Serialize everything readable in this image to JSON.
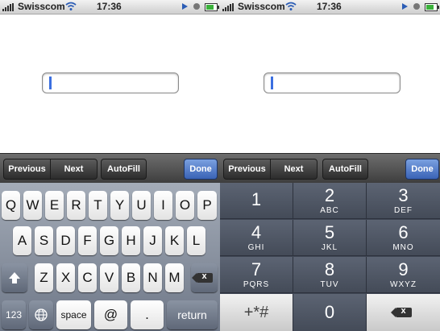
{
  "status_bar": {
    "carrier": "Swisscom",
    "time": "17:36"
  },
  "accessory_bar": {
    "previous": "Previous",
    "next": "Next",
    "autofill": "AutoFill",
    "done": "Done"
  },
  "keyboard": {
    "row1": [
      "Q",
      "W",
      "E",
      "R",
      "T",
      "Y",
      "U",
      "I",
      "O",
      "P"
    ],
    "row2": [
      "A",
      "S",
      "D",
      "F",
      "G",
      "H",
      "J",
      "K",
      "L"
    ],
    "row3": [
      "Z",
      "X",
      "C",
      "V",
      "B",
      "N",
      "M"
    ],
    "numbers_key": "123",
    "space_key": "space",
    "at_key": "@",
    "dot_key": ".",
    "return_key": "return",
    "shift_icon": "shift-arrow-icon",
    "globe_icon": "globe-icon",
    "backspace_icon": "backspace-icon",
    "backspace_glyph": "x"
  },
  "number_pad": {
    "keys": [
      {
        "num": "1",
        "letters": ""
      },
      {
        "num": "2",
        "letters": "ABC"
      },
      {
        "num": "3",
        "letters": "DEF"
      },
      {
        "num": "4",
        "letters": "GHI"
      },
      {
        "num": "5",
        "letters": "JKL"
      },
      {
        "num": "6",
        "letters": "MNO"
      },
      {
        "num": "7",
        "letters": "PQRS"
      },
      {
        "num": "8",
        "letters": "TUV"
      },
      {
        "num": "9",
        "letters": "WXYZ"
      }
    ],
    "symbols_key": "+*#",
    "zero_key": "0"
  },
  "colors": {
    "done_button": "#4a72c4",
    "cursor": "#3b6fe0",
    "numpad": "#4d5563"
  }
}
